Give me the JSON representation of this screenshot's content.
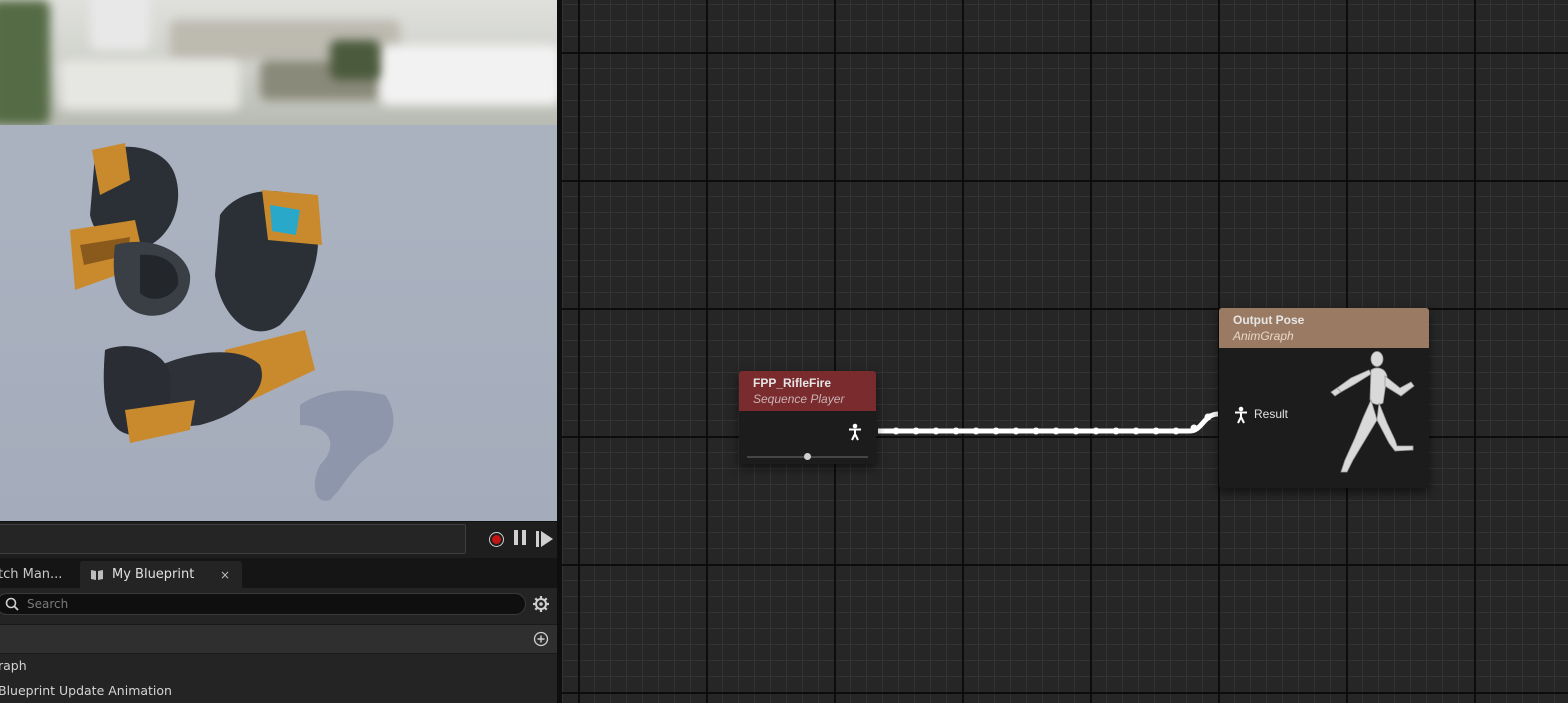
{
  "transport": {
    "record": "record",
    "pause": "pause",
    "play": "play"
  },
  "tabs": {
    "watch_manager": "tch Man...",
    "my_blueprint": "My Blueprint",
    "close_glyph": "×"
  },
  "my_blueprint": {
    "search_placeholder": "Search",
    "items": [
      "raph",
      "Blueprint Update Animation"
    ]
  },
  "graph": {
    "sequence_node": {
      "title": "FPP_RifleFire",
      "subtitle": "Sequence Player",
      "slider_value": 0.5
    },
    "output_node": {
      "title": "Output Pose",
      "subtitle": "AnimGraph",
      "pin_label": "Result"
    }
  },
  "colors": {
    "sequence_header": "#7a2b2e",
    "output_header": "#9a7a63",
    "record_dot": "#c41414"
  },
  "icons": [
    "record-icon",
    "pause-icon",
    "play-icon",
    "book-icon",
    "search-icon",
    "settings-gear-icon",
    "add-circle-icon",
    "pose-pin-icon",
    "mannequin-icon"
  ]
}
